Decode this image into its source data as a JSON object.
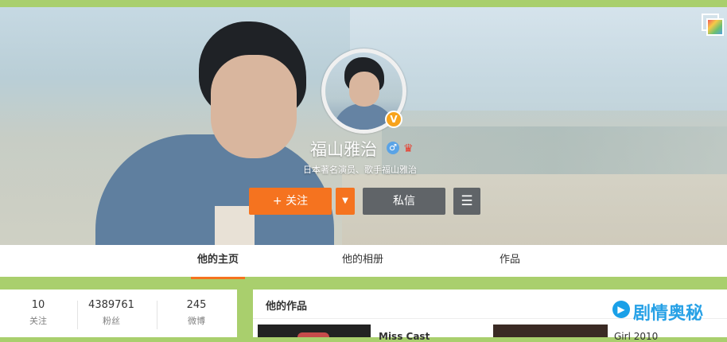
{
  "profile": {
    "name": "福山雅治",
    "gender_icon": "♂",
    "verified_icon": "V",
    "description": "日本著名演员、歌手福山雅治"
  },
  "actions": {
    "follow_label": "+ 关注",
    "dropdown_icon": "▼",
    "message_label": "私信",
    "menu_icon": "☰"
  },
  "tabs": [
    {
      "label": "他的主页",
      "active": true
    },
    {
      "label": "他的相册",
      "active": false
    },
    {
      "label": "作品",
      "active": false
    }
  ],
  "stats": [
    {
      "value": "10",
      "label": "关注"
    },
    {
      "value": "4389761",
      "label": "粉丝"
    },
    {
      "value": "245",
      "label": "微博"
    }
  ],
  "works": {
    "title": "他的作品",
    "items": [
      {
        "title": "Miss Cast"
      },
      {
        "title": "Girl 2010"
      }
    ]
  },
  "watermark": {
    "text": "剧情奥秘"
  },
  "colors": {
    "accent": "#f5731f",
    "page_bg": "#a9cf6d",
    "button_dark": "#606468",
    "watermark_blue": "#27a1e6"
  }
}
